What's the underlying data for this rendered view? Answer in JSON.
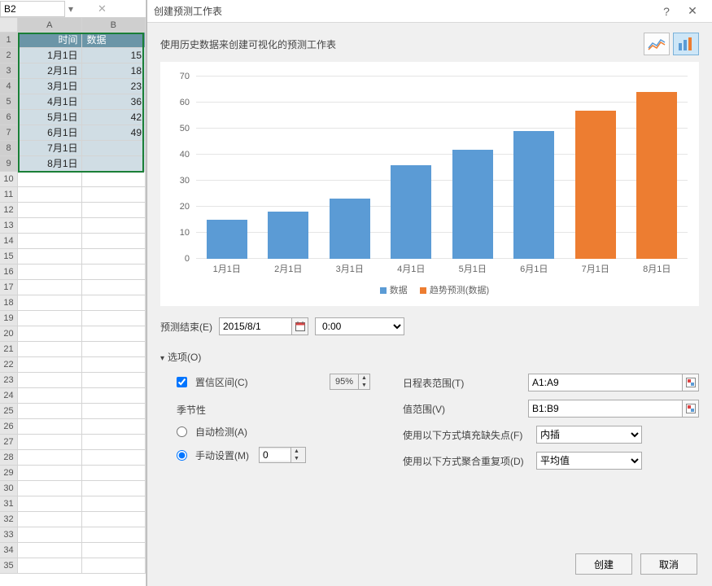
{
  "excel": {
    "name_box": "B2",
    "columns": [
      "A",
      "B"
    ],
    "row_count": 35,
    "header": {
      "c0": "时间",
      "c1": "数据"
    },
    "rows": [
      {
        "c0": "1月1日",
        "c1": "15"
      },
      {
        "c0": "2月1日",
        "c1": "18"
      },
      {
        "c0": "3月1日",
        "c1": "23"
      },
      {
        "c0": "4月1日",
        "c1": "36"
      },
      {
        "c0": "5月1日",
        "c1": "42"
      },
      {
        "c0": "6月1日",
        "c1": "49"
      },
      {
        "c0": "7月1日",
        "c1": ""
      },
      {
        "c0": "8月1日",
        "c1": ""
      }
    ]
  },
  "dialog": {
    "title": "创建预测工作表",
    "help_symbol": "?",
    "close_symbol": "✕",
    "subtitle": "使用历史数据来创建可视化的预测工作表",
    "forecast_end_label": "预测结束(E)",
    "forecast_end_date": "2015/8/1",
    "forecast_end_time": "0:00",
    "options_label": "选项(O)",
    "confidence_label": "置信区间(C)",
    "confidence_value": "95%",
    "seasonality_label": "季节性",
    "auto_detect_label": "自动检测(A)",
    "manual_label": "手动设置(M)",
    "manual_value": "0",
    "timeline_range_label": "日程表范围(T)",
    "timeline_range_value": "A1:A9",
    "values_range_label": "值范围(V)",
    "values_range_value": "B1:B9",
    "fill_missing_label": "使用以下方式填充缺失点(F)",
    "fill_missing_value": "内插",
    "aggregate_label": "使用以下方式聚合重复项(D)",
    "aggregate_value": "平均值",
    "create_btn": "创建",
    "cancel_btn": "取消"
  },
  "chart_data": {
    "type": "bar",
    "categories": [
      "1月1日",
      "2月1日",
      "3月1日",
      "4月1日",
      "5月1日",
      "6月1日",
      "7月1日",
      "8月1日"
    ],
    "series": [
      {
        "name": "数据",
        "color": "blue",
        "values": [
          15,
          18,
          23,
          36,
          42,
          49,
          null,
          null
        ]
      },
      {
        "name": "趋势预测(数据)",
        "color": "orange",
        "values": [
          null,
          null,
          null,
          null,
          null,
          null,
          57,
          64
        ]
      }
    ],
    "ylim": [
      0,
      70
    ],
    "yticks": [
      0,
      10,
      20,
      30,
      40,
      50,
      60,
      70
    ],
    "legend": [
      "数据",
      "趋势预测(数据)"
    ]
  }
}
